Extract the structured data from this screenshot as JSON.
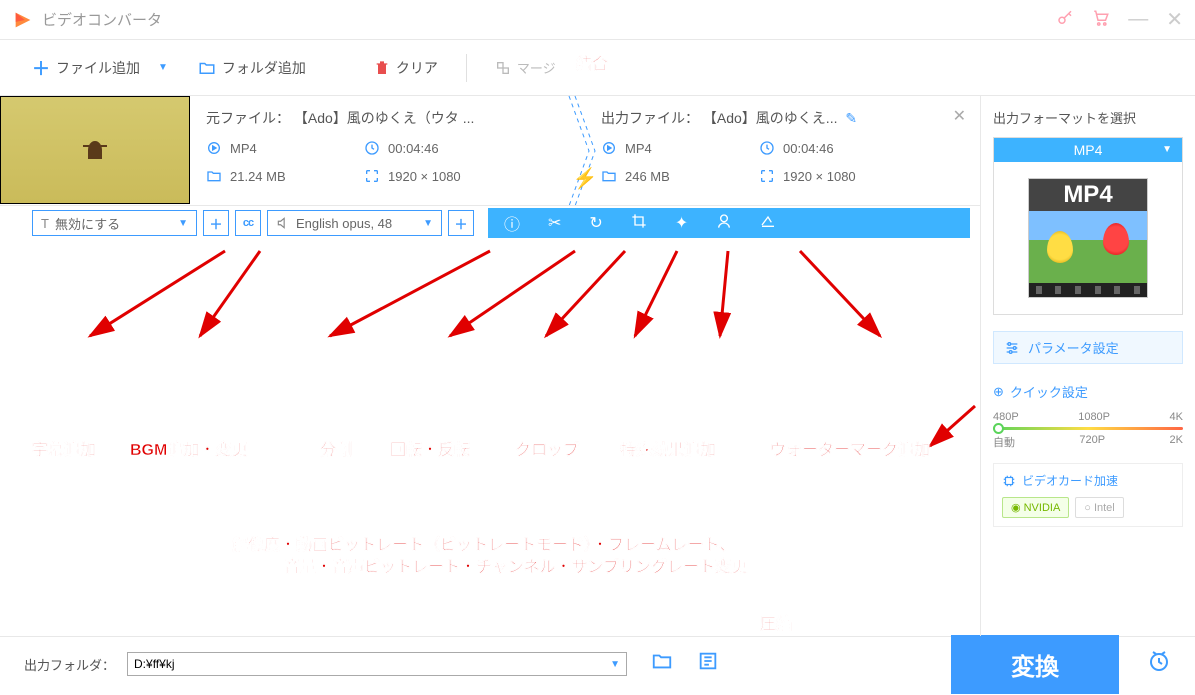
{
  "app": {
    "title": "ビデオコンバータ"
  },
  "topbar": {
    "add_file": "ファイル追加",
    "add_folder": "フォルダ追加",
    "clear": "クリア",
    "merge": "マージ"
  },
  "file": {
    "source": {
      "label": "元ファイル：",
      "name": "【Ado】風のゆくえ（ウタ ...",
      "format": "MP4",
      "duration": "00:04:46",
      "size": "21.24 MB",
      "resolution": "1920 × 1080"
    },
    "output": {
      "label": "出力ファイル：",
      "name": "【Ado】風のゆくえ...",
      "format": "MP4",
      "duration": "00:04:46",
      "size": "246 MB",
      "resolution": "1920 × 1080"
    }
  },
  "editbar": {
    "subtitle_mode": "無効にする",
    "audio_track": "English opus, 48"
  },
  "annotations": {
    "merge": "結合",
    "subtitle": "字幕追加",
    "bgm": "BGM追加・変更",
    "split": "分割",
    "rotate": "回転・反転",
    "crop": "クロップ",
    "effect": "特殊効果追加",
    "watermark": "ウォーターマーク追加",
    "param_line1": "解像度・動画ビットレート（ビットレートモード）・フレームレート、",
    "param_line2": "音量・音声ビットレート・チャンネル・サンプリングレート変更",
    "compress": "圧縮"
  },
  "right": {
    "format_title": "出力フォーマットを選択",
    "format_selected": "MP4",
    "thumb_label": "MP4",
    "params_btn": "パラメータ設定",
    "quick_title": "クイック設定",
    "resolutions": {
      "top": [
        "480P",
        "1080P",
        "4K"
      ],
      "bot": [
        "自動",
        "720P",
        "2K"
      ]
    },
    "gpu_title": "ビデオカード加速",
    "gpu_nvidia": "NVIDIA",
    "gpu_intel": "Intel"
  },
  "bottom": {
    "out_folder_label": "出力フォルダ：",
    "out_folder_path": "D:¥ff¥kj",
    "convert": "変換"
  }
}
